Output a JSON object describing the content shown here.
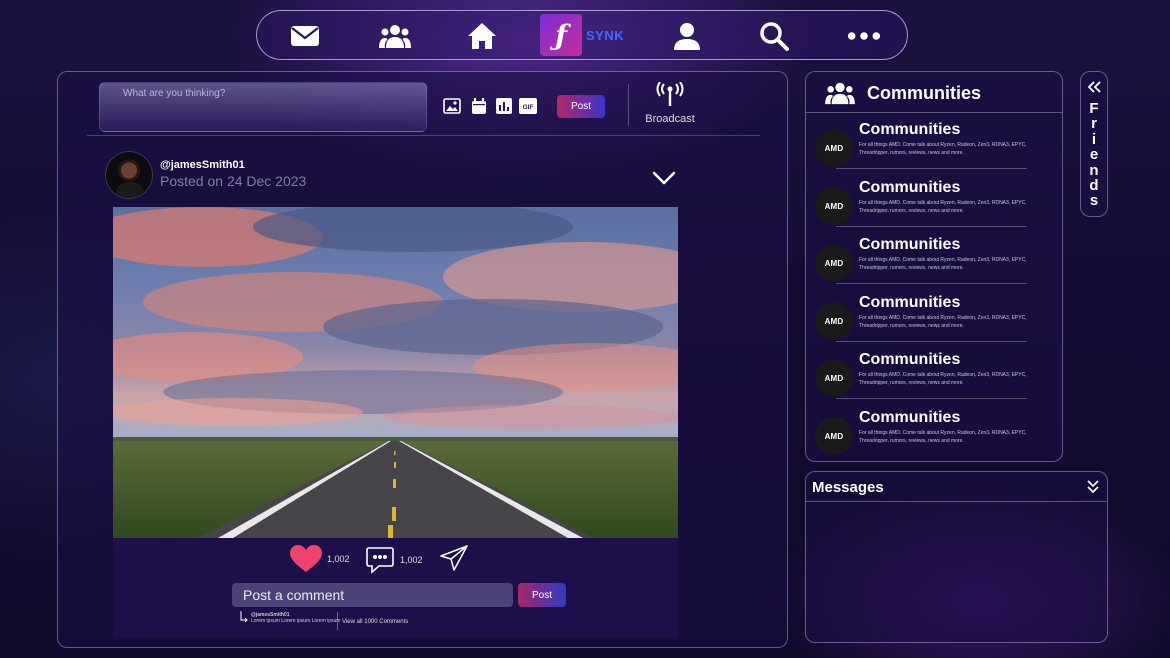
{
  "nav": {
    "brand": "SYNK",
    "logo_glyph": "ƒ",
    "items": [
      {
        "name": "mail-icon",
        "x_label": "Messages"
      },
      {
        "name": "users-icon",
        "x_label": "Friends"
      },
      {
        "name": "home-icon",
        "x_label": "Home"
      },
      {
        "name": "profile-icon",
        "x_label": "Profile"
      },
      {
        "name": "search-icon",
        "x_label": "Search"
      },
      {
        "name": "more-icon",
        "x_label": "More"
      }
    ]
  },
  "composer": {
    "placeholder": "What are you thinking?",
    "post_label": "Post",
    "broadcast_label": "Broadcast",
    "tools": [
      "image-icon",
      "calendar-icon",
      "poll-icon",
      "gif-icon"
    ],
    "gif_label": "GIF"
  },
  "post": {
    "username": "@jamesSmith01",
    "posted": "Posted on 24 Dec 2023",
    "likes": "1,002",
    "comments": "1,002",
    "comment_placeholder": "Post a comment",
    "comment_post_label": "Post",
    "reply_user": "@jamesSmith01",
    "reply_text": "Lorem ipsum Lorem ipsum Lorem ipsum",
    "view_all": "View all 1000 Comments"
  },
  "communities": {
    "title": "Communities",
    "items": [
      {
        "logo": "AMD",
        "title": "Communities",
        "desc": "For all things AMD. Come talk about Ryzen, Radeon, Zen3, RDNA3, EPYC, Threadripper, rumors, reviews, news and more."
      },
      {
        "logo": "AMD",
        "title": "Communities",
        "desc": "For all things AMD. Come talk about Ryzen, Radeon, Zen3, RDNA3, EPYC, Threadripper, rumors, reviews, news and more."
      },
      {
        "logo": "AMD",
        "title": "Communities",
        "desc": "For all things AMD. Come talk about Ryzen, Radeon, Zen3, RDNA3, EPYC, Threadripper, rumors, reviews, news and more."
      },
      {
        "logo": "AMD",
        "title": "Communities",
        "desc": "For all things AMD. Come talk about Ryzen, Radeon, Zen3, RDNA3, EPYC, Threadripper, rumors, reviews, news and more."
      },
      {
        "logo": "AMD",
        "title": "Communities",
        "desc": "For all things AMD. Come talk about Ryzen, Radeon, Zen3, RDNA3, EPYC, Threadripper, rumors, reviews, news and more."
      },
      {
        "logo": "AMD",
        "title": "Communities",
        "desc": "For all things AMD. Come talk about Ryzen, Radeon, Zen3, RDNA3, EPYC, Threadripper, rumors, reviews, news and more."
      }
    ]
  },
  "messages": {
    "title": "Messages"
  },
  "friends": {
    "letters": [
      "F",
      "r",
      "i",
      "e",
      "n",
      "d",
      "s"
    ]
  },
  "colors": {
    "accent_pink": "#b3266a",
    "accent_blue": "#3b36c8",
    "brand_blue": "#3b6cff",
    "heart": "#f0426f"
  }
}
